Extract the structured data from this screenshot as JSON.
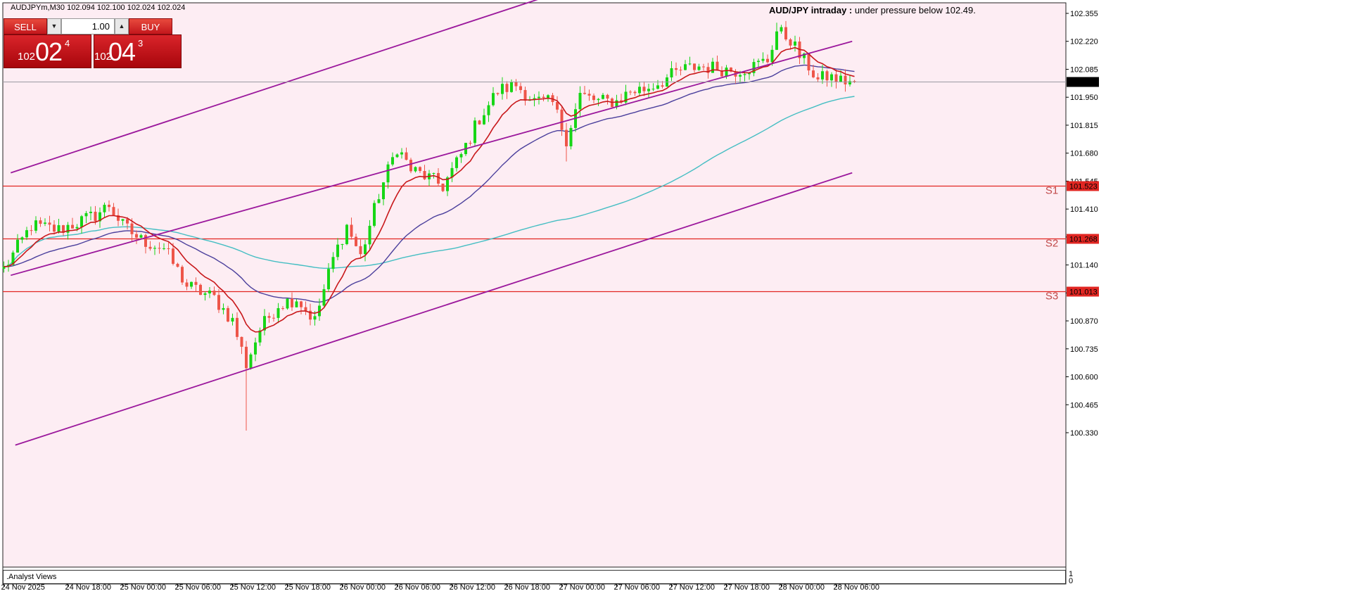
{
  "header": {
    "symbol": "AUDJPYm,M30",
    "ohlc": "102.094 102.100 102.024 102.024"
  },
  "trade_panel": {
    "sell_label": "SELL",
    "buy_label": "BUY",
    "lot": "1.00",
    "down_icon": "triangle-down-icon",
    "up_icon": "triangle-up-icon",
    "sell_quote": {
      "prefix": "102",
      "big": "02",
      "sup": "4"
    },
    "buy_quote": {
      "prefix": "102",
      "big": "04",
      "sup": "3"
    }
  },
  "colors": {
    "background": "#fdedf3",
    "bull": "#16d616",
    "bear": "#ee5549",
    "ema_fast": "#c8171a",
    "ma_mid": "#4b3f9c",
    "ma_slow": "#45bec3",
    "channel": "#9b189c",
    "level": "#e12622",
    "level_label": "#c14a4a",
    "current": "#000000"
  },
  "chart_data": {
    "type": "candlestick",
    "ylim": [
      100.25,
      102.425
    ],
    "current_price": 102.024,
    "y_ticks": [
      "102.355",
      "102.220",
      "102.085",
      "101.950",
      "101.815",
      "101.680",
      "101.545",
      "101.410",
      "101.275",
      "101.140",
      "101.005",
      "100.870",
      "100.735",
      "100.600",
      "100.465",
      "100.330"
    ],
    "x_ticks": [
      "24 Nov 2025",
      "24 Nov 18:00",
      "25 Nov 00:00",
      "25 Nov 06:00",
      "25 Nov 12:00",
      "25 Nov 18:00",
      "26 Nov 00:00",
      "26 Nov 06:00",
      "26 Nov 12:00",
      "26 Nov 18:00",
      "27 Nov 00:00",
      "27 Nov 06:00",
      "27 Nov 12:00",
      "27 Nov 18:00",
      "28 Nov 00:00",
      "28 Nov 06:00"
    ],
    "x_tick_bar": [
      0,
      14,
      26,
      38,
      50,
      62,
      74,
      86,
      98,
      110,
      122,
      134,
      146,
      158,
      170,
      182
    ],
    "bar_count": 187,
    "anchors": [
      [
        0,
        101.12
      ],
      [
        6,
        101.33
      ],
      [
        12,
        101.31
      ],
      [
        20,
        101.38
      ],
      [
        23,
        101.43
      ],
      [
        26,
        101.33
      ],
      [
        30,
        101.26
      ],
      [
        35,
        101.22
      ],
      [
        40,
        101.04
      ],
      [
        46,
        100.98
      ],
      [
        50,
        100.87
      ],
      [
        53,
        100.66
      ],
      [
        56,
        100.83
      ],
      [
        60,
        100.95
      ],
      [
        64,
        100.98
      ],
      [
        68,
        100.87
      ],
      [
        72,
        101.17
      ],
      [
        75,
        101.33
      ],
      [
        78,
        101.18
      ],
      [
        82,
        101.48
      ],
      [
        86,
        101.71
      ],
      [
        89,
        101.6
      ],
      [
        93,
        101.56
      ],
      [
        96,
        101.52
      ],
      [
        100,
        101.67
      ],
      [
        104,
        101.85
      ],
      [
        108,
        101.98
      ],
      [
        112,
        102.01
      ],
      [
        116,
        101.93
      ],
      [
        120,
        101.92
      ],
      [
        123,
        101.75
      ],
      [
        126,
        101.96
      ],
      [
        130,
        101.93
      ],
      [
        134,
        101.93
      ],
      [
        137,
        101.98
      ],
      [
        140,
        101.99
      ],
      [
        144,
        102.03
      ],
      [
        148,
        102.08
      ],
      [
        152,
        102.1
      ],
      [
        156,
        102.09
      ],
      [
        160,
        102.08
      ],
      [
        164,
        102.1
      ],
      [
        167,
        102.13
      ],
      [
        169,
        102.27
      ],
      [
        172,
        102.23
      ],
      [
        174,
        102.15
      ],
      [
        176,
        102.1
      ],
      [
        178,
        102.03
      ],
      [
        180,
        102.05
      ],
      [
        183,
        102.03
      ],
      [
        186,
        102.024
      ]
    ],
    "levels": [
      {
        "name": "S1",
        "value": 101.523,
        "label": "101.523"
      },
      {
        "name": "S2",
        "value": 101.268,
        "label": "101.268"
      },
      {
        "name": "S3",
        "value": 101.013,
        "label": "101.013"
      }
    ],
    "channel_lines": [
      {
        "b1": 1.5,
        "p1": 101.585,
        "b2": 118.5,
        "p2": 102.435
      },
      {
        "b1": 1.5,
        "p1": 101.09,
        "b2": 185.5,
        "p2": 102.22
      },
      {
        "b1": 2.5,
        "p1": 100.27,
        "b2": 185.5,
        "p2": 101.585
      }
    ]
  },
  "analyst": {
    "title": ".Analyst Views",
    "comment_title": "AUD/JPY intraday :",
    "comment_text": "under pressure below 102.49."
  },
  "subwindow_ticks": [
    "1",
    "0"
  ]
}
